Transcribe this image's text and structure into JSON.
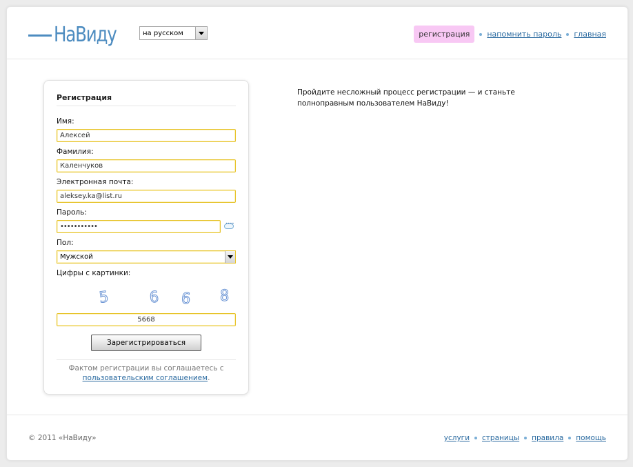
{
  "header": {
    "logo_text": "НаВиду",
    "language": "на русском",
    "nav": {
      "active": "регистрация",
      "links": [
        "напомнить пароль",
        "главная"
      ]
    }
  },
  "form": {
    "title": "Регистрация",
    "first_name_label": "Имя:",
    "first_name_value": "Алексей",
    "last_name_label": "Фамилия:",
    "last_name_value": "Каленчуков",
    "email_label": "Электронная почта:",
    "email_value": "aleksey.ka@list.ru",
    "password_label": "Пароль:",
    "password_value": "•••••••••••",
    "gender_label": "Пол:",
    "gender_value": "Мужской",
    "captcha_label": "Цифры с картинки:",
    "captcha_digits": [
      "5",
      "6",
      "6",
      "8"
    ],
    "captcha_value": "5668",
    "submit_label": "Зарегистрироваться",
    "agreement_text": "Фактом регистрации вы соглашаетесь с",
    "agreement_link": "пользовательским соглашением",
    "agreement_end": "."
  },
  "intro_text": "Пройдите несложный процесс регистрации — и станьте полноправным пользователем НаВиду!",
  "footer": {
    "copyright": "© 2011 «НаВиду»",
    "links": [
      "услуги",
      "страницы",
      "правила",
      "помощь"
    ]
  },
  "colors": {
    "brand": "#4d8cc0",
    "link": "#2a6aa0",
    "active_nav": "#f8c8f4",
    "field_border": "#e6c227"
  }
}
